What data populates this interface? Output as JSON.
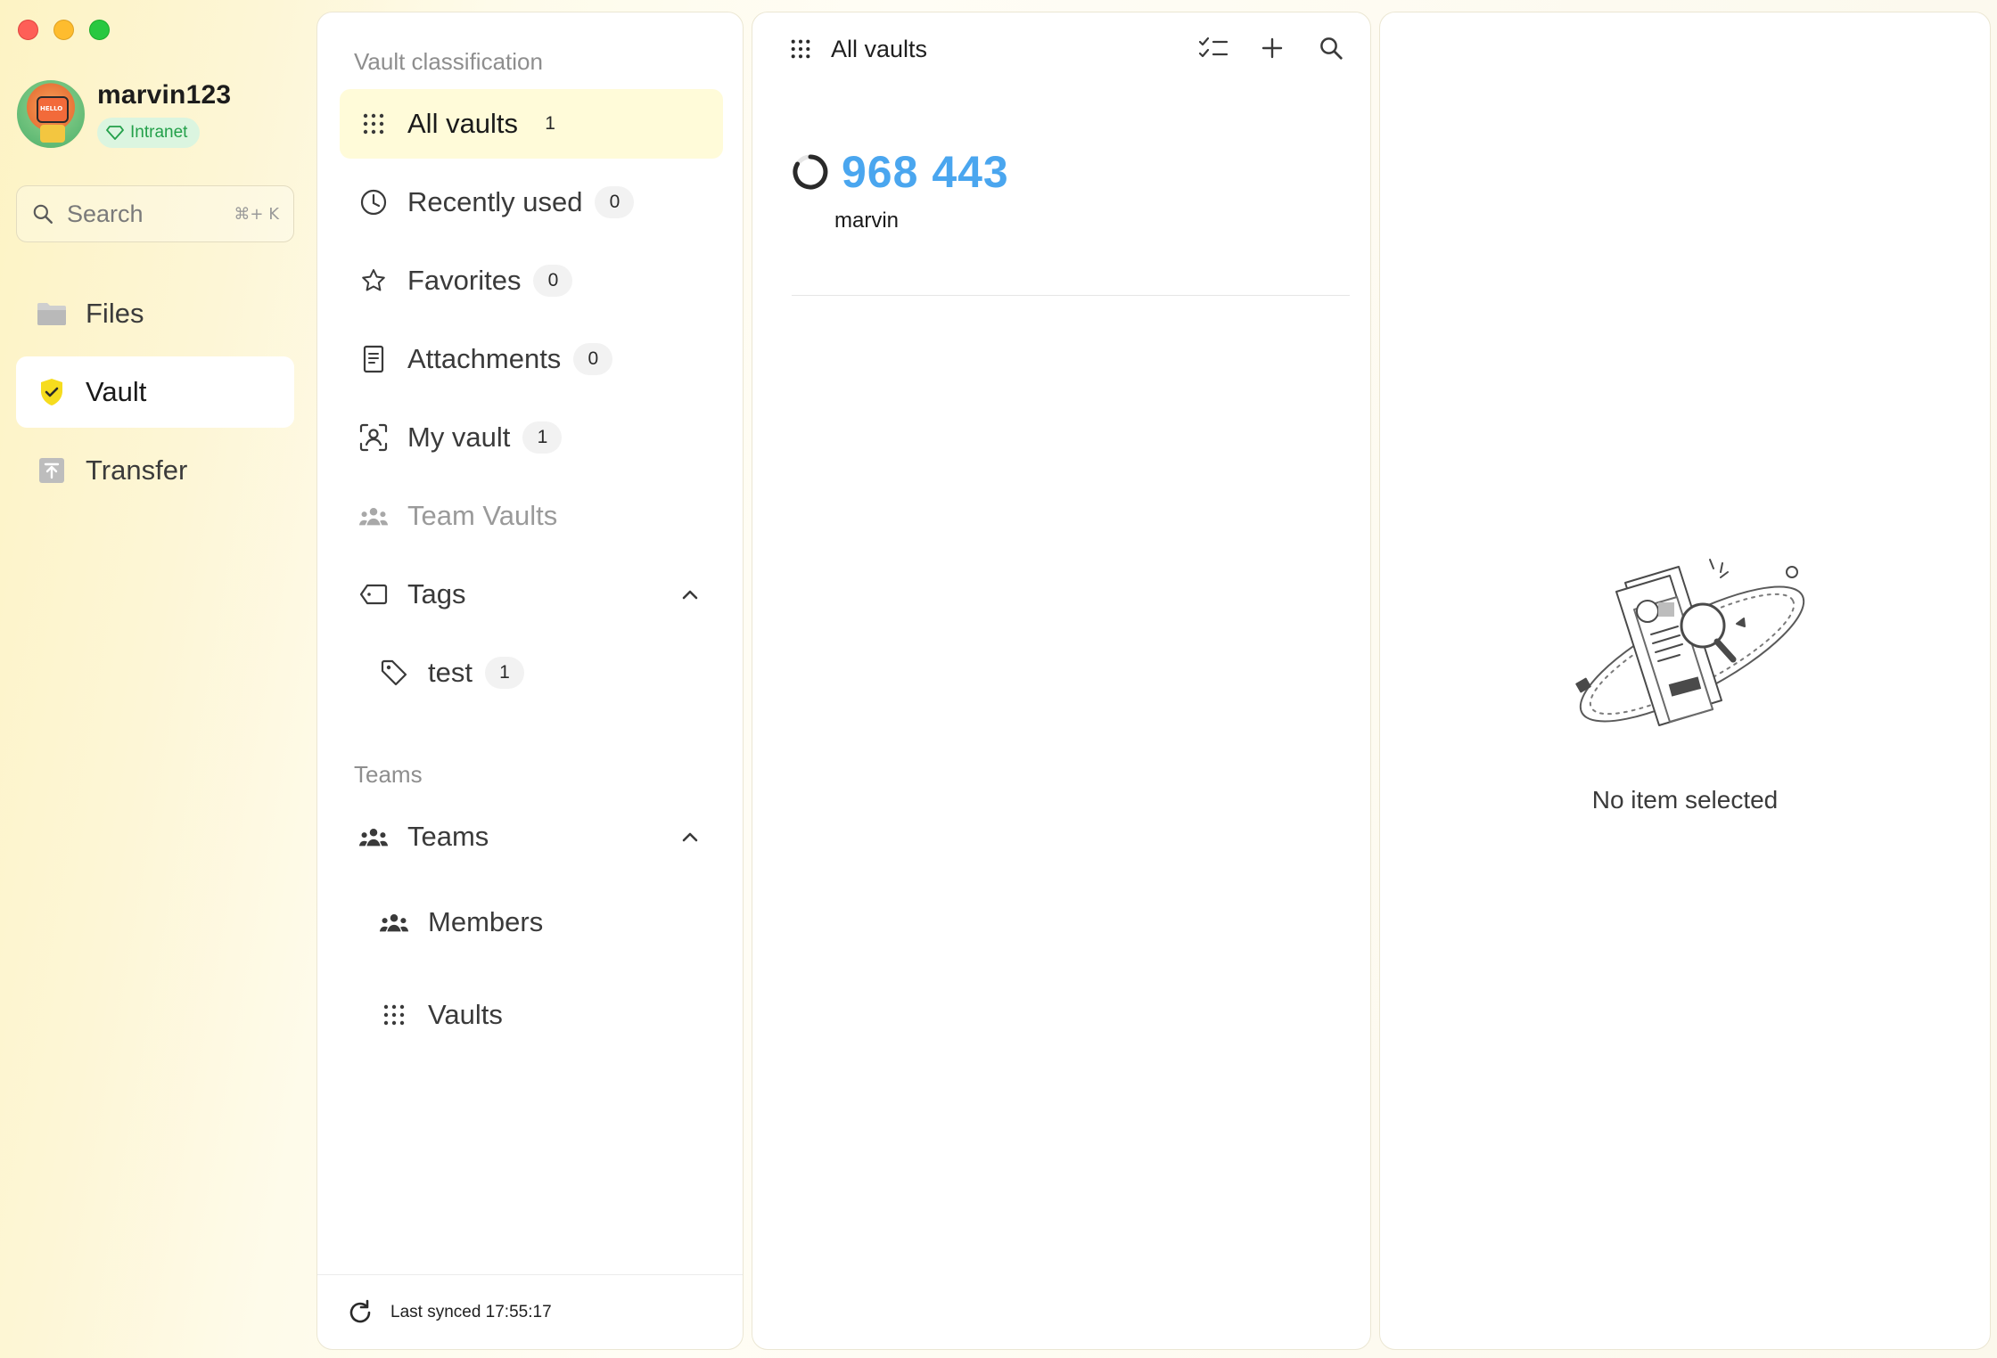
{
  "window": {
    "controls": [
      "close",
      "minimize",
      "zoom"
    ]
  },
  "profile": {
    "username": "marvin123",
    "network_badge": "Intranet"
  },
  "search": {
    "placeholder": "Search",
    "shortcut": "⌘+ K"
  },
  "nav": {
    "items": [
      {
        "label": "Files",
        "icon": "folder-icon",
        "active": false
      },
      {
        "label": "Vault",
        "icon": "vault-shield-icon",
        "active": true
      },
      {
        "label": "Transfer",
        "icon": "transfer-icon",
        "active": false
      }
    ]
  },
  "classification": {
    "section_title": "Vault classification",
    "items": [
      {
        "label": "All vaults",
        "count": "1",
        "icon": "grid-icon"
      },
      {
        "label": "Recently used",
        "count": "0",
        "icon": "clock-icon"
      },
      {
        "label": "Favorites",
        "count": "0",
        "icon": "star-icon"
      },
      {
        "label": "Attachments",
        "count": "0",
        "icon": "document-icon"
      },
      {
        "label": "My vault",
        "count": "1",
        "icon": "person-frame-icon"
      },
      {
        "label": "Team Vaults",
        "icon": "team-icon"
      }
    ],
    "tags_label": "Tags",
    "tags": [
      {
        "label": "test",
        "count": "1"
      }
    ],
    "teams_section_title": "Teams",
    "teams_label": "Teams",
    "team_sub_items": [
      {
        "label": "Members"
      },
      {
        "label": "Vaults"
      }
    ],
    "last_synced": "Last synced 17:55:17"
  },
  "list": {
    "title": "All vaults",
    "entries": [
      {
        "otp": "968 443",
        "name": "marvin"
      }
    ]
  },
  "detail": {
    "empty_text": "No item selected"
  },
  "colors": {
    "accent_blue": "#4aa6ef",
    "active_highlight": "#fffbd9",
    "intranet_green": "#23a04a"
  }
}
